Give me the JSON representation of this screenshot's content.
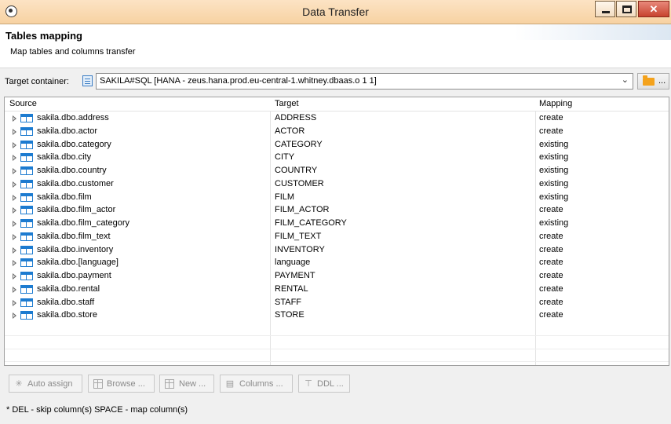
{
  "window": {
    "title": "Data Transfer",
    "close_glyph": "✕"
  },
  "header": {
    "title": "Tables mapping",
    "description": "Map tables and columns transfer"
  },
  "target": {
    "label": "Target container:",
    "value": "SAKILA#SQL  [HANA - zeus.hana.prod.eu-central-1.whitney.dbaas.o 1 1]",
    "dots": "..."
  },
  "grid": {
    "columns": [
      "Source",
      "Target",
      "Mapping"
    ],
    "rows": [
      {
        "source": "sakila.dbo.address",
        "target": "ADDRESS",
        "mapping": "create"
      },
      {
        "source": "sakila.dbo.actor",
        "target": "ACTOR",
        "mapping": "create"
      },
      {
        "source": "sakila.dbo.category",
        "target": "CATEGORY",
        "mapping": "existing"
      },
      {
        "source": "sakila.dbo.city",
        "target": "CITY",
        "mapping": "existing"
      },
      {
        "source": "sakila.dbo.country",
        "target": "COUNTRY",
        "mapping": "existing"
      },
      {
        "source": "sakila.dbo.customer",
        "target": "CUSTOMER",
        "mapping": "existing"
      },
      {
        "source": "sakila.dbo.film",
        "target": "FILM",
        "mapping": "existing"
      },
      {
        "source": "sakila.dbo.film_actor",
        "target": "FILM_ACTOR",
        "mapping": "create"
      },
      {
        "source": "sakila.dbo.film_category",
        "target": "FILM_CATEGORY",
        "mapping": "existing"
      },
      {
        "source": "sakila.dbo.film_text",
        "target": "FILM_TEXT",
        "mapping": "create"
      },
      {
        "source": "sakila.dbo.inventory",
        "target": "INVENTORY",
        "mapping": "create"
      },
      {
        "source": "sakila.dbo.[language]",
        "target": "language",
        "mapping": "create"
      },
      {
        "source": "sakila.dbo.payment",
        "target": "PAYMENT",
        "mapping": "create"
      },
      {
        "source": "sakila.dbo.rental",
        "target": "RENTAL",
        "mapping": "create"
      },
      {
        "source": "sakila.dbo.staff",
        "target": "STAFF",
        "mapping": "create"
      },
      {
        "source": "sakila.dbo.store",
        "target": "STORE",
        "mapping": "create"
      }
    ]
  },
  "buttons": {
    "auto_assign": "Auto assign",
    "browse": "Browse ...",
    "new": "New ...",
    "columns": "Columns ...",
    "ddl": "DDL ..."
  },
  "hint": "* DEL - skip column(s)  SPACE - map column(s)",
  "colors": {
    "title_bar": "#f7d2a2",
    "table_icon": "#1c7bd0",
    "folder": "#f4a21c"
  }
}
